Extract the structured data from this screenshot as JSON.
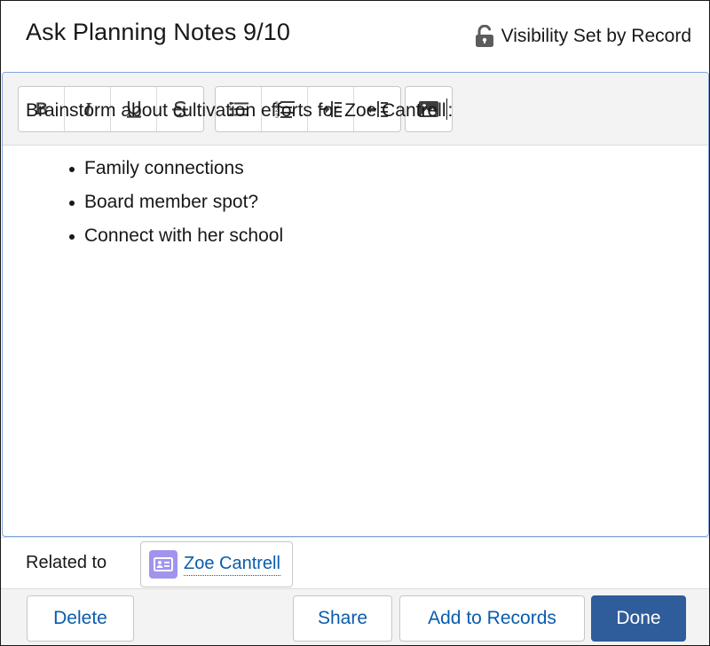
{
  "header": {
    "title": "Ask Planning Notes 9/10",
    "visibility_label": "Visibility Set by Record",
    "visibility_icon": "unlock-icon"
  },
  "toolbar": {
    "groups": [
      [
        {
          "name": "bold",
          "icon": "bold-icon"
        },
        {
          "name": "italic",
          "icon": "italic-icon"
        },
        {
          "name": "underline",
          "icon": "underline-icon"
        },
        {
          "name": "strikethrough",
          "icon": "strikethrough-icon"
        }
      ],
      [
        {
          "name": "bulleted-list",
          "icon": "bulleted-list-icon"
        },
        {
          "name": "numbered-list",
          "icon": "numbered-list-icon"
        },
        {
          "name": "indent",
          "icon": "indent-icon"
        },
        {
          "name": "outdent",
          "icon": "outdent-icon"
        }
      ],
      [
        {
          "name": "insert-image",
          "icon": "image-icon"
        }
      ]
    ]
  },
  "body": {
    "paragraph": "Brainstorm about cultivation efforts for Zoe Cantrell",
    "paragraph_end": ":",
    "bullets": [
      "Family connections",
      "Board member spot?",
      "Connect with her school"
    ]
  },
  "related": {
    "label": "Related to",
    "record_name": "Zoe Cantrell",
    "record_icon": "contact-card-icon",
    "icon_color": "#a094ed"
  },
  "footer": {
    "delete_label": "Delete",
    "share_label": "Share",
    "add_to_records_label": "Add to Records",
    "done_label": "Done"
  },
  "colors": {
    "accent": "#0b5cab",
    "primary_button": "#2f5c9a",
    "editor_focus_border": "#7fa6dd"
  }
}
